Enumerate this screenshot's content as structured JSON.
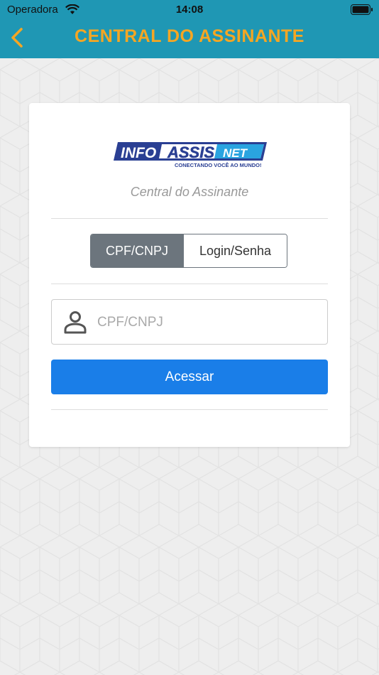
{
  "status_bar": {
    "carrier": "Operadora",
    "time": "14:08"
  },
  "header": {
    "title": "CENTRAL DO ASSINANTE"
  },
  "card": {
    "logo": {
      "left": "INFO",
      "middle": "ASSIS",
      "right": "NET",
      "tagline": "CONECTANDO VOCÊ AO MUNDO!"
    },
    "subtitle": "Central do Assinante",
    "tabs": [
      {
        "label": "CPF/CNPJ",
        "active": true
      },
      {
        "label": "Login/Senha",
        "active": false
      }
    ],
    "input": {
      "placeholder": "CPF/CNPJ",
      "value": ""
    },
    "submit_label": "Acessar"
  },
  "colors": {
    "header_bg": "#1f97b4",
    "header_title": "#f5a623",
    "button": "#1a7ee8",
    "tab_active": "#6c757d"
  }
}
